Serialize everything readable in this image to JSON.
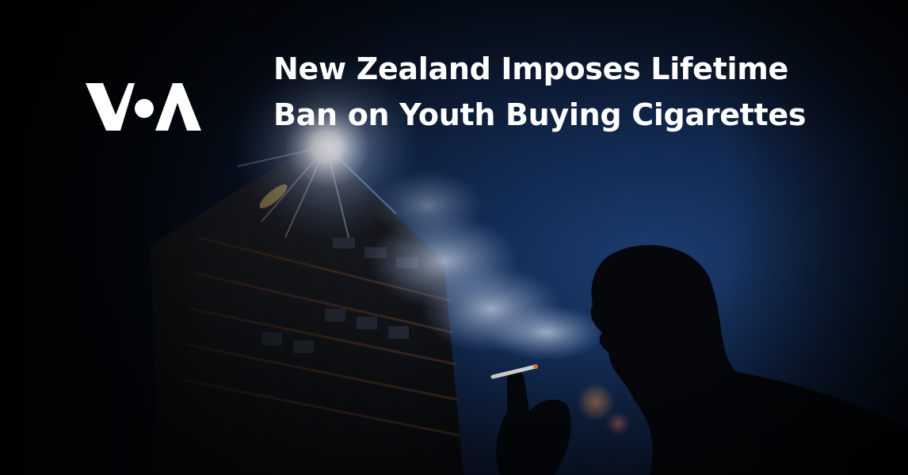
{
  "brand": {
    "logo_text": "VOA"
  },
  "headline": {
    "line1": "New Zealand Imposes Lifetime",
    "line2": "Ban on Youth Buying Cigarettes"
  },
  "photo": {
    "scene": "Silhouette of a man smoking a cigarette against a blue sky beside a tall building with a sun flare"
  },
  "colors": {
    "sky_deep": "#0c1a33",
    "sky_mid": "#1c3c6e",
    "text": "#ffffff"
  }
}
